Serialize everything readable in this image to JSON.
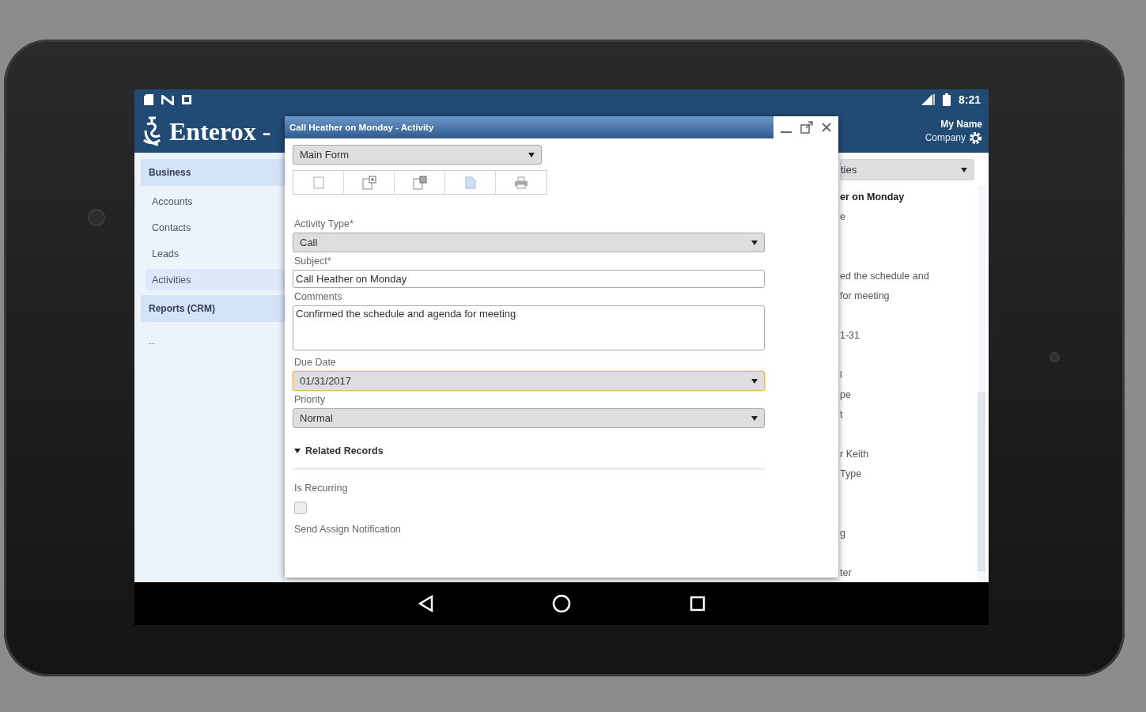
{
  "status_bar": {
    "time": "8:21"
  },
  "app": {
    "title": "Enterox -",
    "user_name": "My Name",
    "company": "Company"
  },
  "sidebar": {
    "sections": [
      {
        "label": "Business",
        "items": [
          {
            "label": "Accounts",
            "selected": false
          },
          {
            "label": "Contacts",
            "selected": false
          },
          {
            "label": "Leads",
            "selected": false
          },
          {
            "label": "Activities",
            "selected": true
          }
        ]
      },
      {
        "label": "Reports (CRM)"
      }
    ],
    "footer": "--"
  },
  "background_panel": {
    "view_selector": "ties",
    "lines": [
      {
        "text": "er on Monday",
        "bold": true
      },
      {
        "text": "e",
        "bold": false
      },
      {
        "text": "ed the schedule and",
        "bold": false
      },
      {
        "text": "for meeting",
        "bold": false
      },
      {
        "text": "1-31",
        "bold": false
      },
      {
        "text": "l",
        "bold": false
      },
      {
        "text": "pe",
        "bold": false
      },
      {
        "text": "t",
        "bold": false
      },
      {
        "text": "r Keith",
        "bold": false
      },
      {
        "text": "Type",
        "bold": false
      },
      {
        "text": "g",
        "bold": false
      },
      {
        "text": "ter",
        "bold": false
      }
    ]
  },
  "dialog": {
    "title": "Call Heather on Monday - Activity",
    "form_selector": "Main Form",
    "toolbar": [
      {
        "kind": "blank"
      },
      {
        "kind": "add"
      },
      {
        "kind": "copy"
      },
      {
        "kind": "page"
      },
      {
        "kind": "print"
      }
    ],
    "fields": [
      {
        "kind": "select",
        "label": "Activity Type*",
        "value": "Call",
        "focused": false
      },
      {
        "kind": "text",
        "label": "Subject*",
        "value": "Call Heather on Monday"
      },
      {
        "kind": "textarea",
        "label": "Comments",
        "value": "Confirmed the schedule and agenda for meeting"
      },
      {
        "kind": "select",
        "label": "Due Date",
        "value": "01/31/2017",
        "focused": true
      },
      {
        "kind": "select",
        "label": "Priority",
        "value": "Normal",
        "focused": false
      }
    ],
    "section": {
      "label": "Related Records",
      "expanded": true
    },
    "extra_fields": [
      {
        "kind": "checkbox",
        "label": "Is Recurring",
        "checked": false
      },
      {
        "kind": "label",
        "label": "Send Assign Notification"
      }
    ]
  }
}
